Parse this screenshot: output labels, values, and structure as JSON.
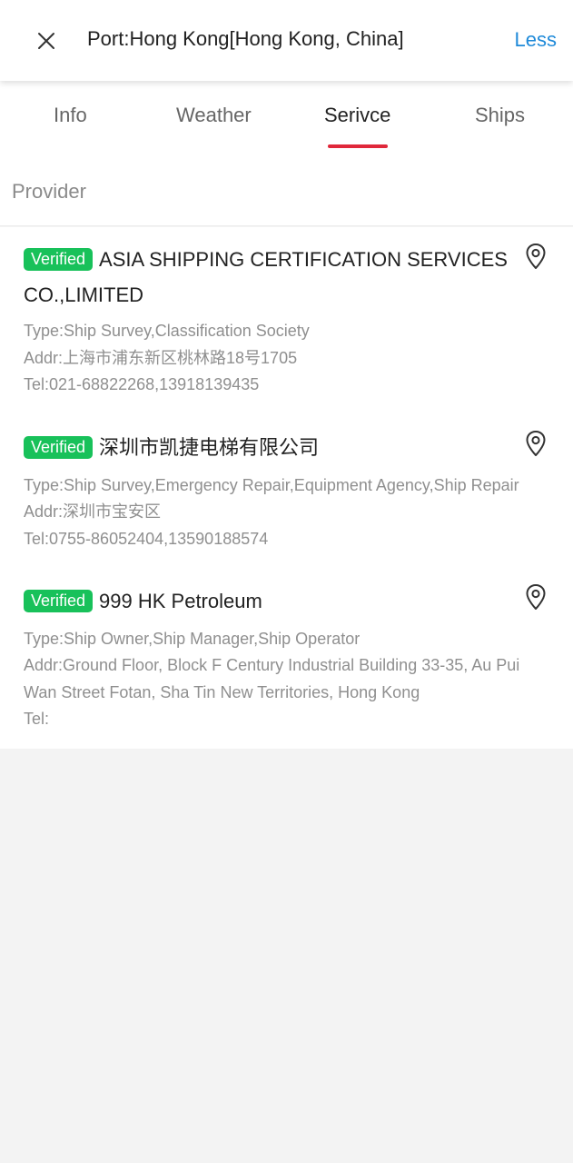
{
  "header": {
    "title": "Port:Hong Kong[Hong Kong, China]",
    "less_label": "Less"
  },
  "tabs": [
    {
      "label": "Info",
      "active": false
    },
    {
      "label": "Weather",
      "active": false
    },
    {
      "label": "Serivce",
      "active": true
    },
    {
      "label": "Ships",
      "active": false
    }
  ],
  "section": {
    "title": "Provider"
  },
  "providers": [
    {
      "badge": "Verified",
      "name": "ASIA SHIPPING CERTIFICATION SERVICES CO.,LIMITED",
      "type": "Type:Ship Survey,Classification Society",
      "addr": "Addr:上海市浦东新区桃林路18号1705",
      "tel": "Tel:021-68822268,13918139435"
    },
    {
      "badge": "Verified",
      "name": "深圳市凯捷电梯有限公司",
      "type": "Type:Ship Survey,Emergency Repair,Equipment Agency,Ship Repair",
      "addr": "Addr:深圳市宝安区",
      "tel": "Tel:0755-86052404,13590188574"
    },
    {
      "badge": "Verified",
      "name": "999 HK Petroleum",
      "type": "Type:Ship Owner,Ship Manager,Ship Operator",
      "addr": "Addr:Ground Floor, Block F Century Industrial Building 33-35, Au Pui Wan Street Fotan, Sha Tin New Territories, Hong Kong",
      "tel": "Tel:"
    }
  ],
  "icons": {
    "close": "close-icon",
    "location": "location-pin-icon"
  },
  "colors": {
    "accent_link": "#1f8ad9",
    "tab_indicator": "#e0283b",
    "verified_badge": "#18c15a"
  }
}
